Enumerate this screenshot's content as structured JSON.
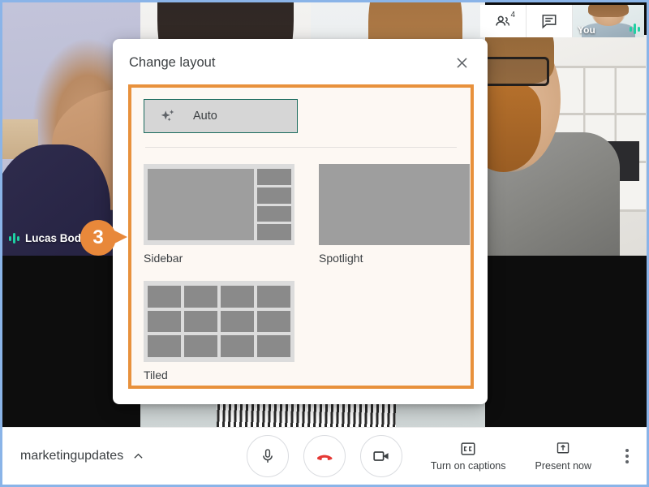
{
  "meeting": {
    "participant_name": "Lucas Bod...",
    "self_label": "You",
    "participant_count": "4"
  },
  "callout": {
    "step_number": "3"
  },
  "dialog": {
    "title": "Change layout",
    "close_icon": "close-icon",
    "auto_option": {
      "label": "Auto",
      "icon": "sparkle-icon",
      "selected": true
    },
    "options": [
      {
        "label": "Sidebar",
        "preview": "sidebar-preview"
      },
      {
        "label": "Spotlight",
        "preview": "spotlight-preview"
      },
      {
        "label": "Tiled",
        "preview": "tiled-preview"
      }
    ],
    "highlight_color": "#e8913c",
    "selected_border_color": "#1a6b5d"
  },
  "toolbar": {
    "meeting_code": "marketingupdates",
    "expand_icon": "chevron-up-icon",
    "mic_icon": "microphone-icon",
    "hangup_icon": "end-call-icon",
    "camera_icon": "video-camera-icon",
    "captions_label": "Turn on captions",
    "captions_icon": "closed-caption-icon",
    "present_label": "Present now",
    "present_icon": "present-screen-icon",
    "more_icon": "more-vertical-icon",
    "hangup_color": "#e53935"
  },
  "top_bar": {
    "people_icon": "people-icon",
    "chat_icon": "chat-icon"
  }
}
